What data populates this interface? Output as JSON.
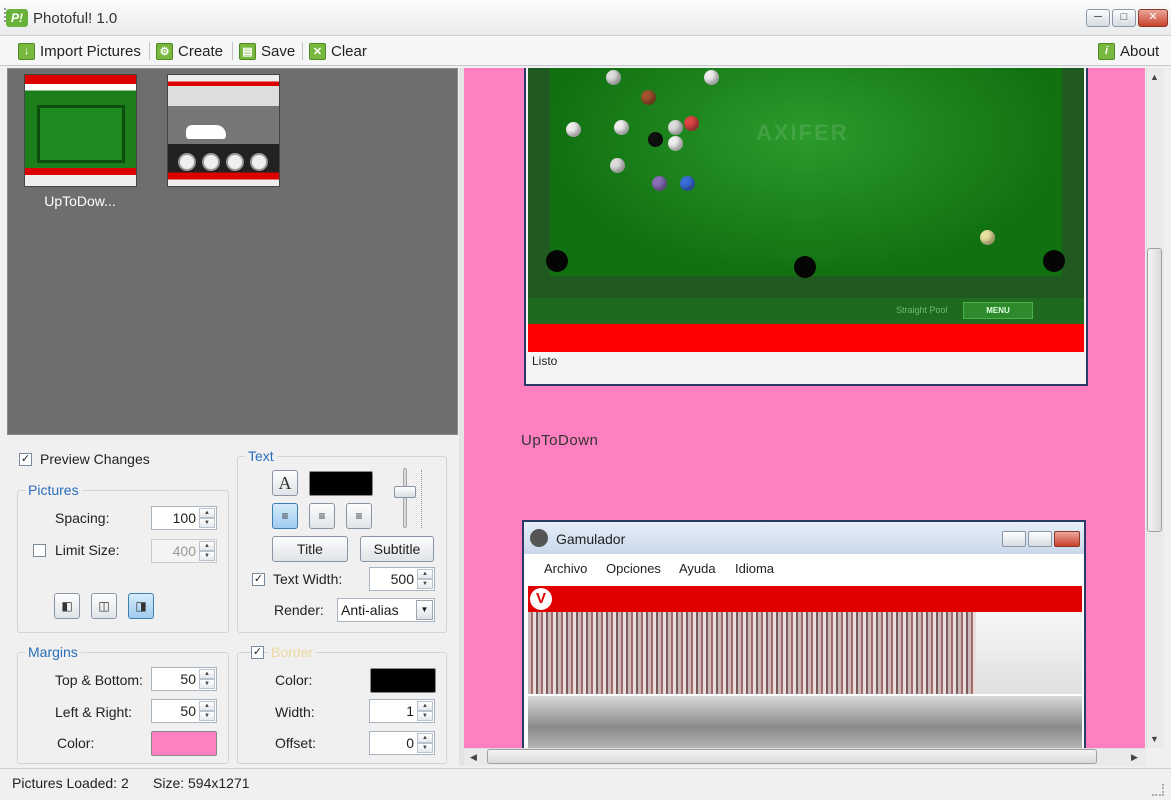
{
  "window": {
    "title": "Photoful! 1.0",
    "logo_text": "P!"
  },
  "toolbar": {
    "import_label": "Import Pictures",
    "create_label": "Create",
    "save_label": "Save",
    "clear_label": "Clear",
    "about_label": "About"
  },
  "gallery": {
    "items": [
      {
        "caption": "UpToDow..."
      },
      {
        "caption": ""
      }
    ]
  },
  "settings": {
    "preview_changes": {
      "label": "Preview Changes",
      "checked": true
    },
    "pictures": {
      "title": "Pictures",
      "spacing_label": "Spacing:",
      "spacing_value": "100",
      "limit_size_label": "Limit Size:",
      "limit_size_checked": false,
      "limit_size_value": "400"
    },
    "text": {
      "title": "Text",
      "font_icon": "A",
      "title_button": "Title",
      "subtitle_button": "Subtitle",
      "text_width_label": "Text Width:",
      "text_width_checked": true,
      "text_width_value": "500",
      "render_label": "Render:",
      "render_value": "Anti-alias",
      "color": "#000000"
    },
    "margins": {
      "title": "Margins",
      "top_bottom_label": "Top & Bottom:",
      "top_bottom_value": "50",
      "left_right_label": "Left & Right:",
      "left_right_value": "50",
      "color_label": "Color:",
      "color": "#ff80c0"
    },
    "border": {
      "title": "Border",
      "checked": true,
      "color_label": "Color:",
      "color": "#000000",
      "width_label": "Width:",
      "width_value": "1",
      "offset_label": "Offset:",
      "offset_value": "0"
    }
  },
  "preview": {
    "background": "#ff80c0",
    "pool_shot": {
      "watermark": "AXIFER",
      "menu_label": "MENU",
      "footer_text": "Straight Pool",
      "status": "Listo"
    },
    "caption_1": "UpToDown",
    "gamulador_shot": {
      "title": "Gamulador",
      "menu": [
        "Archivo",
        "Opciones",
        "Ayuda",
        "Idioma"
      ],
      "logo_text": "V"
    }
  },
  "statusbar": {
    "pictures_loaded": "Pictures Loaded: 2",
    "size": "Size: 594x1271"
  }
}
